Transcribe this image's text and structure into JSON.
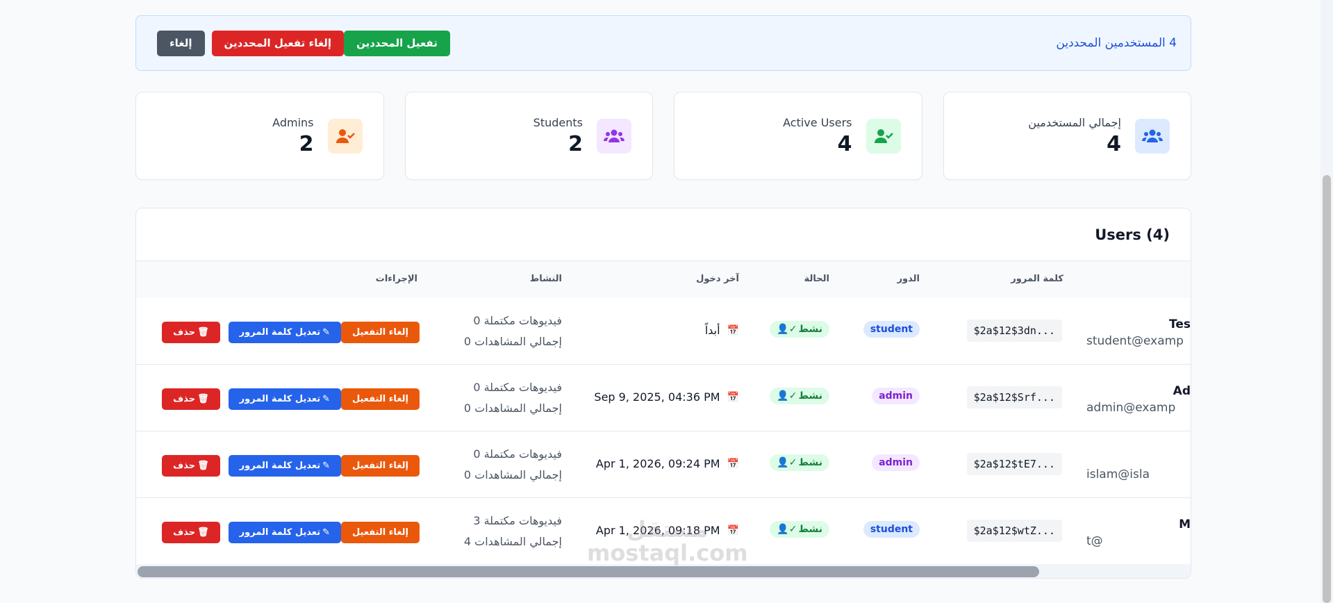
{
  "selection": {
    "count_text": "4 المستخدمين المحددين",
    "activate_label": "تفعيل المحددين",
    "deactivate_label": "إلغاء تفعيل المحددين",
    "cancel_label": "إلغاء"
  },
  "stats": [
    {
      "label": "إجمالي المستخدمين",
      "value": "4",
      "icon": "users-icon",
      "color": "#2563eb"
    },
    {
      "label": "Active Users",
      "value": "4",
      "icon": "user-check-icon",
      "color": "#16a34a"
    },
    {
      "label": "Students",
      "value": "2",
      "icon": "users-icon",
      "color": "#9333ea"
    },
    {
      "label": "Admins",
      "value": "2",
      "icon": "user-check-icon",
      "color": "#ea580c"
    }
  ],
  "table": {
    "title": "Users (4)",
    "headers": {
      "password": "كلمة المرور",
      "role": "الدور",
      "status": "الحالة",
      "last_login": "آخر دخول",
      "activity": "النشاط",
      "actions": "الإجراءات"
    },
    "rows": [
      {
        "name": "Tes",
        "email": "student@examp",
        "password": "$2a$12$3dn...",
        "role": "student",
        "status": "نشط",
        "last_login": "أبداً",
        "completed": "0 فيديوهات مكتملة",
        "views": "0 إجمالي المشاهدات"
      },
      {
        "name": "Ad",
        "email": "admin@examp",
        "password": "$2a$12$Srf...",
        "role": "admin",
        "status": "نشط",
        "last_login": "Sep 9, 2025, 04:36 PM",
        "completed": "0 فيديوهات مكتملة",
        "views": "0 إجمالي المشاهدات"
      },
      {
        "name": "",
        "email": "islam@isla",
        "password": "$2a$12$tE7...",
        "role": "admin",
        "status": "نشط",
        "last_login": "Apr 1, 2026, 09:24 PM",
        "completed": "0 فيديوهات مكتملة",
        "views": "0 إجمالي المشاهدات"
      },
      {
        "name": "M",
        "email": "t@",
        "password": "$2a$12$wtZ...",
        "role": "student",
        "status": "نشط",
        "last_login": "Apr 1, 2026, 09:18 PM",
        "completed": "3 فيديوهات مكتملة",
        "views": "4 إجمالي المشاهدات"
      }
    ],
    "action_labels": {
      "deactivate": "إلغاء التفعيل",
      "edit_password": "تعديل كلمة المرور",
      "delete": "حذف"
    }
  },
  "watermark": {
    "line1": "مستقل",
    "line2": "mostaql.com"
  }
}
